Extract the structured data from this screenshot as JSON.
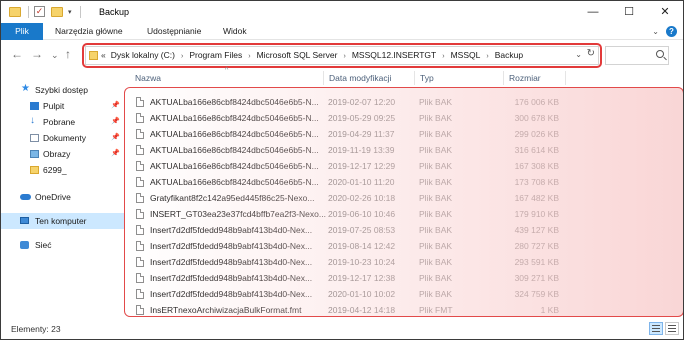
{
  "window": {
    "title": "Backup",
    "minimize_glyph": "—",
    "maximize_glyph": "☐",
    "close_glyph": "✕",
    "quick_access_check": "✓",
    "quick_access_dropdown": "▾"
  },
  "ribbon": {
    "tabs": [
      "Plik",
      "Narzędzia główne",
      "Udostępnianie",
      "Widok"
    ],
    "collapse_glyph": "⌄",
    "help_glyph": "?"
  },
  "nav": {
    "back_glyph": "←",
    "forward_glyph": "→",
    "recent_glyph": "⌄",
    "up_glyph": "↑",
    "more_glyph": "«",
    "breadcrumbs": [
      "Dysk lokalny (C:)",
      "Program Files",
      "Microsoft SQL Server",
      "MSSQL12.INSERTGT",
      "MSSQL",
      "Backup"
    ],
    "separator_glyph": "›",
    "dropdown_glyph": "⌄",
    "refresh_glyph": "↻",
    "search_placeholder": ""
  },
  "sidebar": {
    "items": [
      {
        "label": "Szybki dostęp",
        "icon": "star-icon"
      },
      {
        "label": "Pulpit",
        "icon": "desktop-icon",
        "pinned": true
      },
      {
        "label": "Pobrane",
        "icon": "download-icon",
        "pinned": true
      },
      {
        "label": "Dokumenty",
        "icon": "documents-icon",
        "pinned": true
      },
      {
        "label": "Obrazy",
        "icon": "pictures-icon",
        "pinned": true
      },
      {
        "label": "6299_",
        "icon": "folder-icon"
      },
      {
        "label": "OneDrive",
        "icon": "cloud-icon"
      },
      {
        "label": "Ten komputer",
        "icon": "computer-icon",
        "selected": true
      },
      {
        "label": "Sieć",
        "icon": "network-icon"
      }
    ],
    "pin_glyph": "📌"
  },
  "columns": {
    "name": "Nazwa",
    "date": "Data modyfikacji",
    "type": "Typ",
    "size": "Rozmiar",
    "sort_glyph": "^"
  },
  "files": [
    {
      "name": "AKTUALba166e86cbf8424dbc5046e6b5-N...",
      "date": "2019-02-07 12:20",
      "type": "Plik BAK",
      "size": "176 006 KB"
    },
    {
      "name": "AKTUALba166e86cbf8424dbc5046e6b5-N...",
      "date": "2019-05-29 09:25",
      "type": "Plik BAK",
      "size": "300 678 KB"
    },
    {
      "name": "AKTUALba166e86cbf8424dbc5046e6b5-N...",
      "date": "2019-04-29 11:37",
      "type": "Plik BAK",
      "size": "299 026 KB"
    },
    {
      "name": "AKTUALba166e86cbf8424dbc5046e6b5-N...",
      "date": "2019-11-19 13:39",
      "type": "Plik BAK",
      "size": "316 614 KB"
    },
    {
      "name": "AKTUALba166e86cbf8424dbc5046e6b5-N...",
      "date": "2019-12-17 12:29",
      "type": "Plik BAK",
      "size": "167 308 KB"
    },
    {
      "name": "AKTUALba166e86cbf8424dbc5046e6b5-N...",
      "date": "2020-01-10 11:20",
      "type": "Plik BAK",
      "size": "173 708 KB"
    },
    {
      "name": "Gratyfikant8f2c142a95ed445f86c25-Nexo...",
      "date": "2020-02-26 10:18",
      "type": "Plik BAK",
      "size": "167 482 KB"
    },
    {
      "name": "INSERT_GT03ea23e37fcd4bffb7ea2f3-Nexo...",
      "date": "2019-06-10 10:46",
      "type": "Plik BAK",
      "size": "179 910 KB"
    },
    {
      "name": "Insert7d2df5fdedd948b9abf413b4d0-Nex...",
      "date": "2019-07-25 08:53",
      "type": "Plik BAK",
      "size": "439 127 KB"
    },
    {
      "name": "Insert7d2df5fdedd948b9abf413b4d0-Nex...",
      "date": "2019-08-14 12:42",
      "type": "Plik BAK",
      "size": "280 727 KB"
    },
    {
      "name": "Insert7d2df5fdedd948b9abf413b4d0-Nex...",
      "date": "2019-10-23 10:24",
      "type": "Plik BAK",
      "size": "293 591 KB"
    },
    {
      "name": "Insert7d2df5fdedd948b9abf413b4d0-Nex...",
      "date": "2019-12-17 12:38",
      "type": "Plik BAK",
      "size": "309 271 KB"
    },
    {
      "name": "Insert7d2df5fdedd948b9abf413b4d0-Nex...",
      "date": "2020-01-10 10:02",
      "type": "Plik BAK",
      "size": "324 759 KB"
    },
    {
      "name": "InsERTnexoArchiwizacjaBulkFormat.fmt",
      "date": "2019-04-12 14:18",
      "type": "Plik FMT",
      "size": "1 KB"
    }
  ],
  "status": {
    "items_count": "Elementy: 23"
  },
  "colors": {
    "accent": "#1979ca",
    "highlight_border": "#e23a3a",
    "selected_bg": "#cce8ff"
  }
}
